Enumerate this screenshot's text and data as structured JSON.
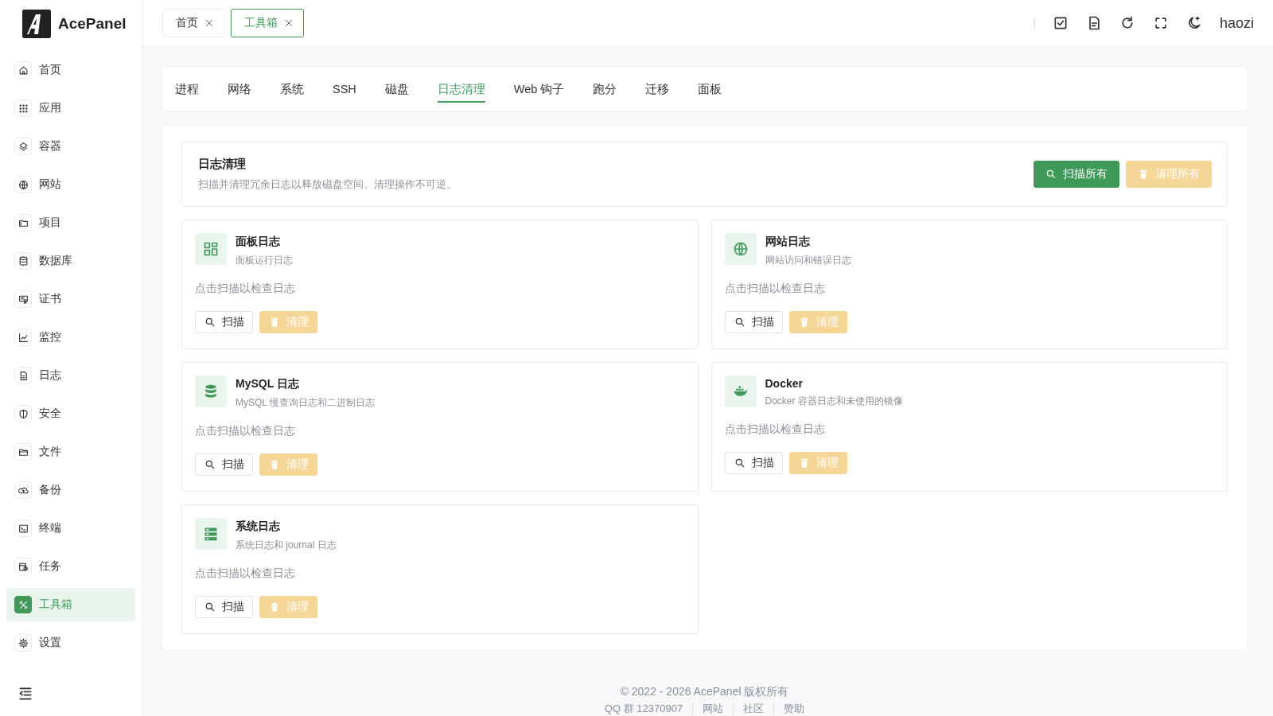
{
  "brand": {
    "name": "AcePanel"
  },
  "sidebar": {
    "items": [
      {
        "label": "首页",
        "selected": false
      },
      {
        "label": "应用",
        "selected": false
      },
      {
        "label": "容器",
        "selected": false
      },
      {
        "label": "网站",
        "selected": false
      },
      {
        "label": "项目",
        "selected": false
      },
      {
        "label": "数据库",
        "selected": false
      },
      {
        "label": "证书",
        "selected": false
      },
      {
        "label": "监控",
        "selected": false
      },
      {
        "label": "日志",
        "selected": false
      },
      {
        "label": "安全",
        "selected": false
      },
      {
        "label": "文件",
        "selected": false
      },
      {
        "label": "备份",
        "selected": false
      },
      {
        "label": "终端",
        "selected": false
      },
      {
        "label": "任务",
        "selected": false
      },
      {
        "label": "工具箱",
        "selected": true
      },
      {
        "label": "设置",
        "selected": false
      }
    ]
  },
  "open_tabs": [
    {
      "label": "首页",
      "selected": false
    },
    {
      "label": "工具箱",
      "selected": true
    }
  ],
  "user": {
    "name": "haozi"
  },
  "tool_tabs": [
    {
      "label": "进程",
      "selected": false
    },
    {
      "label": "网络",
      "selected": false
    },
    {
      "label": "系统",
      "selected": false
    },
    {
      "label": "SSH",
      "selected": false
    },
    {
      "label": "磁盘",
      "selected": false
    },
    {
      "label": "日志清理",
      "selected": true
    },
    {
      "label": "Web 钩子",
      "selected": false
    },
    {
      "label": "跑分",
      "selected": false
    },
    {
      "label": "迁移",
      "selected": false
    },
    {
      "label": "面板",
      "selected": false
    }
  ],
  "log_clean": {
    "title": "日志清理",
    "description": "扫描并清理冗余日志以释放磁盘空间。清理操作不可逆。",
    "scan_all": {
      "label": "扫描所有",
      "disabled": false
    },
    "clean_all": {
      "label": "清理所有",
      "disabled": true
    },
    "cards": [
      {
        "title": "面板日志",
        "subtitle": "面板运行日志",
        "status": "点击扫描以检查日志",
        "scan": {
          "label": "扫描",
          "disabled": false
        },
        "clean": {
          "label": "清理",
          "disabled": true
        }
      },
      {
        "title": "网站日志",
        "subtitle": "网站访问和错误日志",
        "status": "点击扫描以检查日志",
        "scan": {
          "label": "扫描",
          "disabled": false
        },
        "clean": {
          "label": "清理",
          "disabled": true
        }
      },
      {
        "title": "MySQL 日志",
        "subtitle": "MySQL 慢查询日志和二进制日志",
        "status": "点击扫描以检查日志",
        "scan": {
          "label": "扫描",
          "disabled": false
        },
        "clean": {
          "label": "清理",
          "disabled": true
        }
      },
      {
        "title": "Docker",
        "subtitle": "Docker 容器日志和未使用的镜像",
        "status": "点击扫描以检查日志",
        "scan": {
          "label": "扫描",
          "disabled": false
        },
        "clean": {
          "label": "清理",
          "disabled": true
        }
      },
      {
        "title": "系统日志",
        "subtitle": "系统日志和 journal 日志",
        "status": "点击扫描以检查日志",
        "scan": {
          "label": "扫描",
          "disabled": false
        },
        "clean": {
          "label": "清理",
          "disabled": true
        }
      }
    ]
  },
  "footer": {
    "copyright": "© 2022 - 2026 AcePanel 版权所有",
    "links": [
      "QQ 群 12370907",
      "网站",
      "社区",
      "赞助"
    ]
  }
}
